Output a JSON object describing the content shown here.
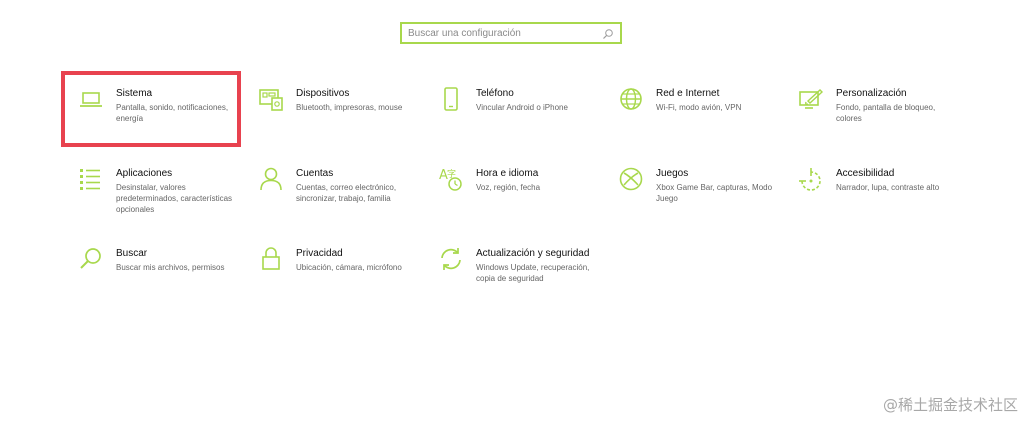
{
  "search": {
    "placeholder": "Buscar una configuración",
    "value": ""
  },
  "colors": {
    "accent": "#a8d84c",
    "highlight": "#e8424f"
  },
  "tiles": [
    {
      "title": "Sistema",
      "desc": "Pantalla, sonido, notificaciones, energía",
      "icon": "laptop-icon"
    },
    {
      "title": "Dispositivos",
      "desc": "Bluetooth, impresoras, mouse",
      "icon": "devices-icon"
    },
    {
      "title": "Teléfono",
      "desc": "Vincular Android o iPhone",
      "icon": "phone-icon"
    },
    {
      "title": "Red e Internet",
      "desc": "Wi-Fi, modo avión, VPN",
      "icon": "globe-icon"
    },
    {
      "title": "Personalización",
      "desc": "Fondo, pantalla de bloqueo, colores",
      "icon": "paint-icon"
    },
    {
      "title": "Aplicaciones",
      "desc": "Desinstalar, valores predeterminados, características opcionales",
      "icon": "apps-list-icon"
    },
    {
      "title": "Cuentas",
      "desc": "Cuentas, correo electrónico, sincronizar, trabajo, familia",
      "icon": "person-icon"
    },
    {
      "title": "Hora e idioma",
      "desc": "Voz, región, fecha",
      "icon": "time-language-icon"
    },
    {
      "title": "Juegos",
      "desc": "Xbox Game Bar, capturas, Modo Juego",
      "icon": "xbox-icon"
    },
    {
      "title": "Accesibilidad",
      "desc": "Narrador, lupa, contraste alto",
      "icon": "accessibility-icon"
    },
    {
      "title": "Buscar",
      "desc": "Buscar mis archivos, permisos",
      "icon": "search-icon"
    },
    {
      "title": "Privacidad",
      "desc": "Ubicación, cámara, micrófono",
      "icon": "lock-icon"
    },
    {
      "title": "Actualización y seguridad",
      "desc": "Windows Update, recuperación, copia de seguridad",
      "icon": "sync-icon"
    }
  ],
  "watermark": "@稀土掘金技术社区"
}
